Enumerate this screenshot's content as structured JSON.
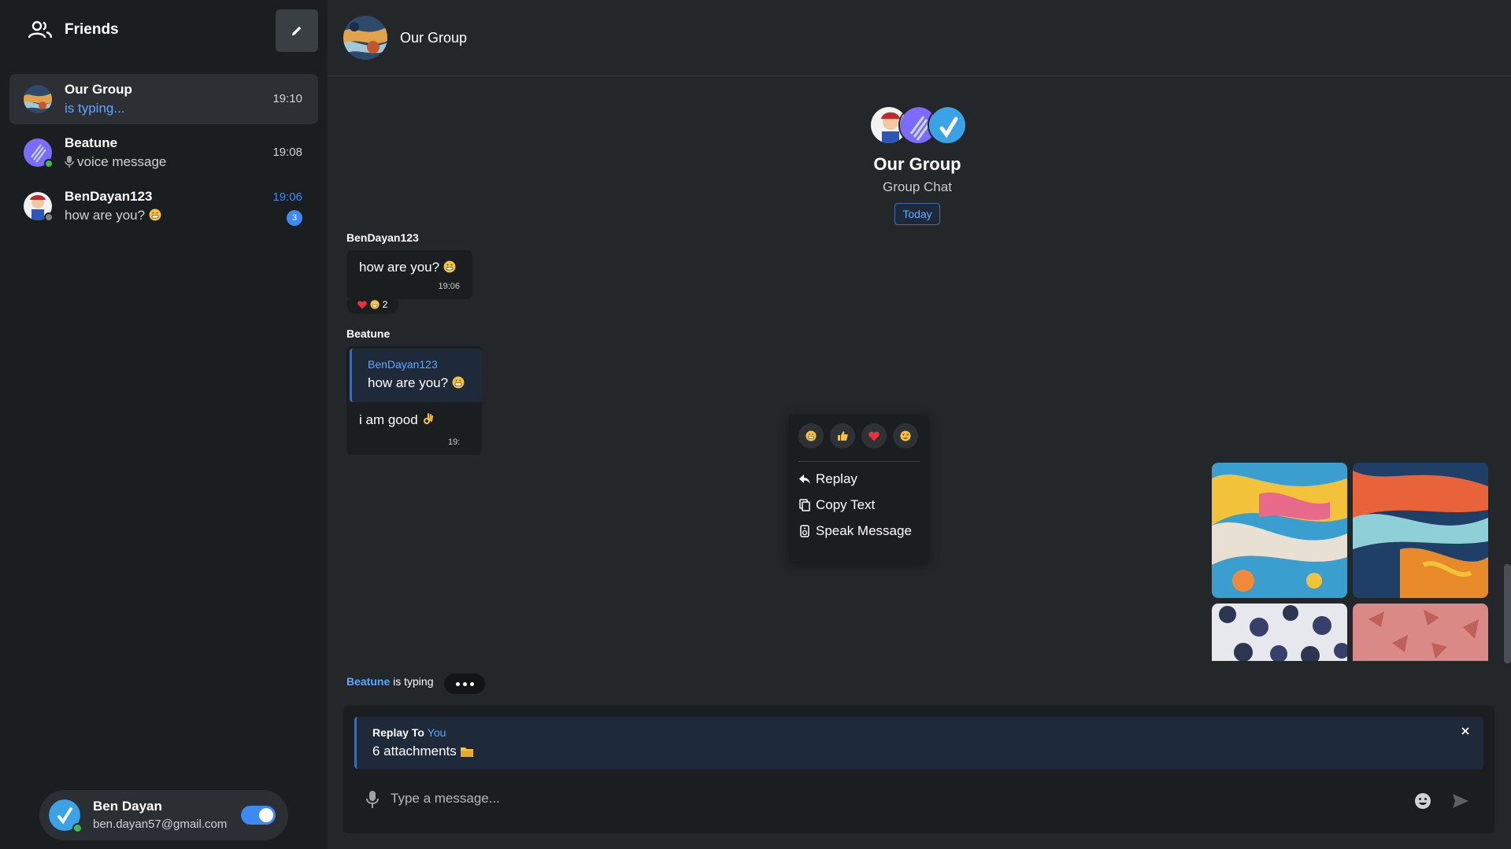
{
  "sidebar": {
    "header": {
      "label": "Friends",
      "icon": "people-icon",
      "compose_icon": "pencil-icon"
    },
    "chats": [
      {
        "name": "Our Group",
        "preview": "is typing...",
        "time": "19:10",
        "active": true
      },
      {
        "name": "Beatune",
        "preview": "voice message",
        "time": "19:08",
        "status": "online"
      },
      {
        "name": "BenDayan123",
        "preview": "how are you?",
        "time": "19:06",
        "unread": "3",
        "status": "offline"
      }
    ],
    "user": {
      "name": "Ben Dayan",
      "email": "ben.dayan57@gmail.com",
      "toggle_on": true
    }
  },
  "topbar": {
    "title": "Our Group"
  },
  "intro": {
    "name": "Our Group",
    "subtitle": "Group Chat",
    "date_badge": "Today"
  },
  "messages": [
    {
      "sender": "BenDayan123",
      "text": "how are you?",
      "time": "19:06",
      "reactions": {
        "count": "2"
      }
    },
    {
      "sender": "Beatune",
      "reply_to": {
        "name": "BenDayan123",
        "text": "how are you?"
      },
      "text": "i am good",
      "time": "19:"
    }
  ],
  "context_menu": {
    "reactions": [
      "grin-emoji",
      "thumbs-up-emoji",
      "heart-emoji",
      "heart-eyes-emoji"
    ],
    "items": [
      {
        "label": "Replay",
        "icon": "reply-icon"
      },
      {
        "label": "Copy Text",
        "icon": "copy-icon"
      },
      {
        "label": "Speak Message",
        "icon": "speaker-icon"
      }
    ]
  },
  "typing": {
    "who": "Beatune",
    "text": "is typing"
  },
  "composer": {
    "reply_title": "Replay To",
    "reply_target": "You",
    "reply_sub": "6 attachments",
    "placeholder": "Type a message..."
  },
  "colors": {
    "accent": "#3d8bf2",
    "link": "#5ea7ff",
    "bg": "#23272a",
    "panel": "#1b1e21"
  }
}
